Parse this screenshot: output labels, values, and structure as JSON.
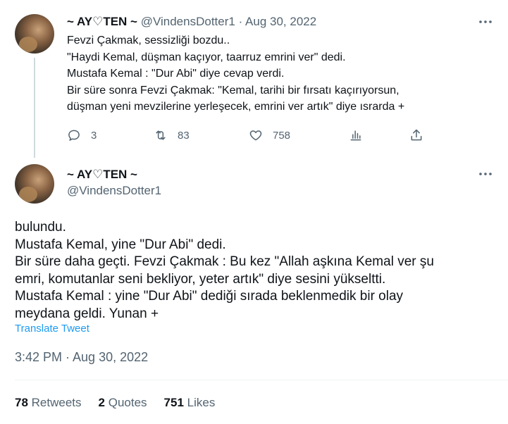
{
  "tweet1": {
    "display_name": "~ AY♡TEN ~",
    "handle": "@VindensDotter1",
    "separator": "·",
    "date": "Aug 30, 2022",
    "lines": [
      "Fevzi Çakmak, sessizliği bozdu..",
      "\"Haydi Kemal, düşman kaçıyor, taarruz emrini ver\" dedi.",
      "Mustafa Kemal : \"Dur Abi\" diye cevap verdi.",
      "Bir süre sonra Fevzi Çakmak: \"Kemal, tarihi bir fırsatı kaçırıyorsun,",
      "düşman yeni mevzilerine yerleşecek, emrini ver artık\" diye ısrarda +"
    ],
    "actions": {
      "replies": "3",
      "retweets": "83",
      "likes": "758"
    }
  },
  "tweet2": {
    "display_name": "~ AY♡TEN ~",
    "handle": "@VindensDotter1",
    "lines": [
      "bulundu.",
      "Mustafa Kemal, yine \"Dur Abi\" dedi.",
      "Bir süre daha geçti. Fevzi Çakmak : Bu kez \"Allah aşkına Kemal ver şu",
      "emri, komutanlar seni bekliyor, yeter artık\" diye sesini yükseltti.",
      "Mustafa Kemal : yine \"Dur Abi\" dediği sırada beklenmedik bir olay",
      "meydana geldi. Yunan +"
    ],
    "translate_label": "Translate Tweet",
    "timestamp": "3:42 PM · Aug 30, 2022",
    "stats": {
      "retweets_count": "78",
      "retweets_label": "Retweets",
      "quotes_count": "2",
      "quotes_label": "Quotes",
      "likes_count": "751",
      "likes_label": "Likes"
    }
  },
  "icons": {
    "more": "more-horizontal-icon",
    "reply": "reply-icon",
    "retweet": "retweet-icon",
    "like": "heart-icon",
    "analytics": "analytics-icon",
    "share": "share-icon"
  },
  "colors": {
    "text": "#0f1419",
    "secondary": "#536471",
    "link": "#1d9bf0",
    "thread_line": "#cfd9de"
  }
}
